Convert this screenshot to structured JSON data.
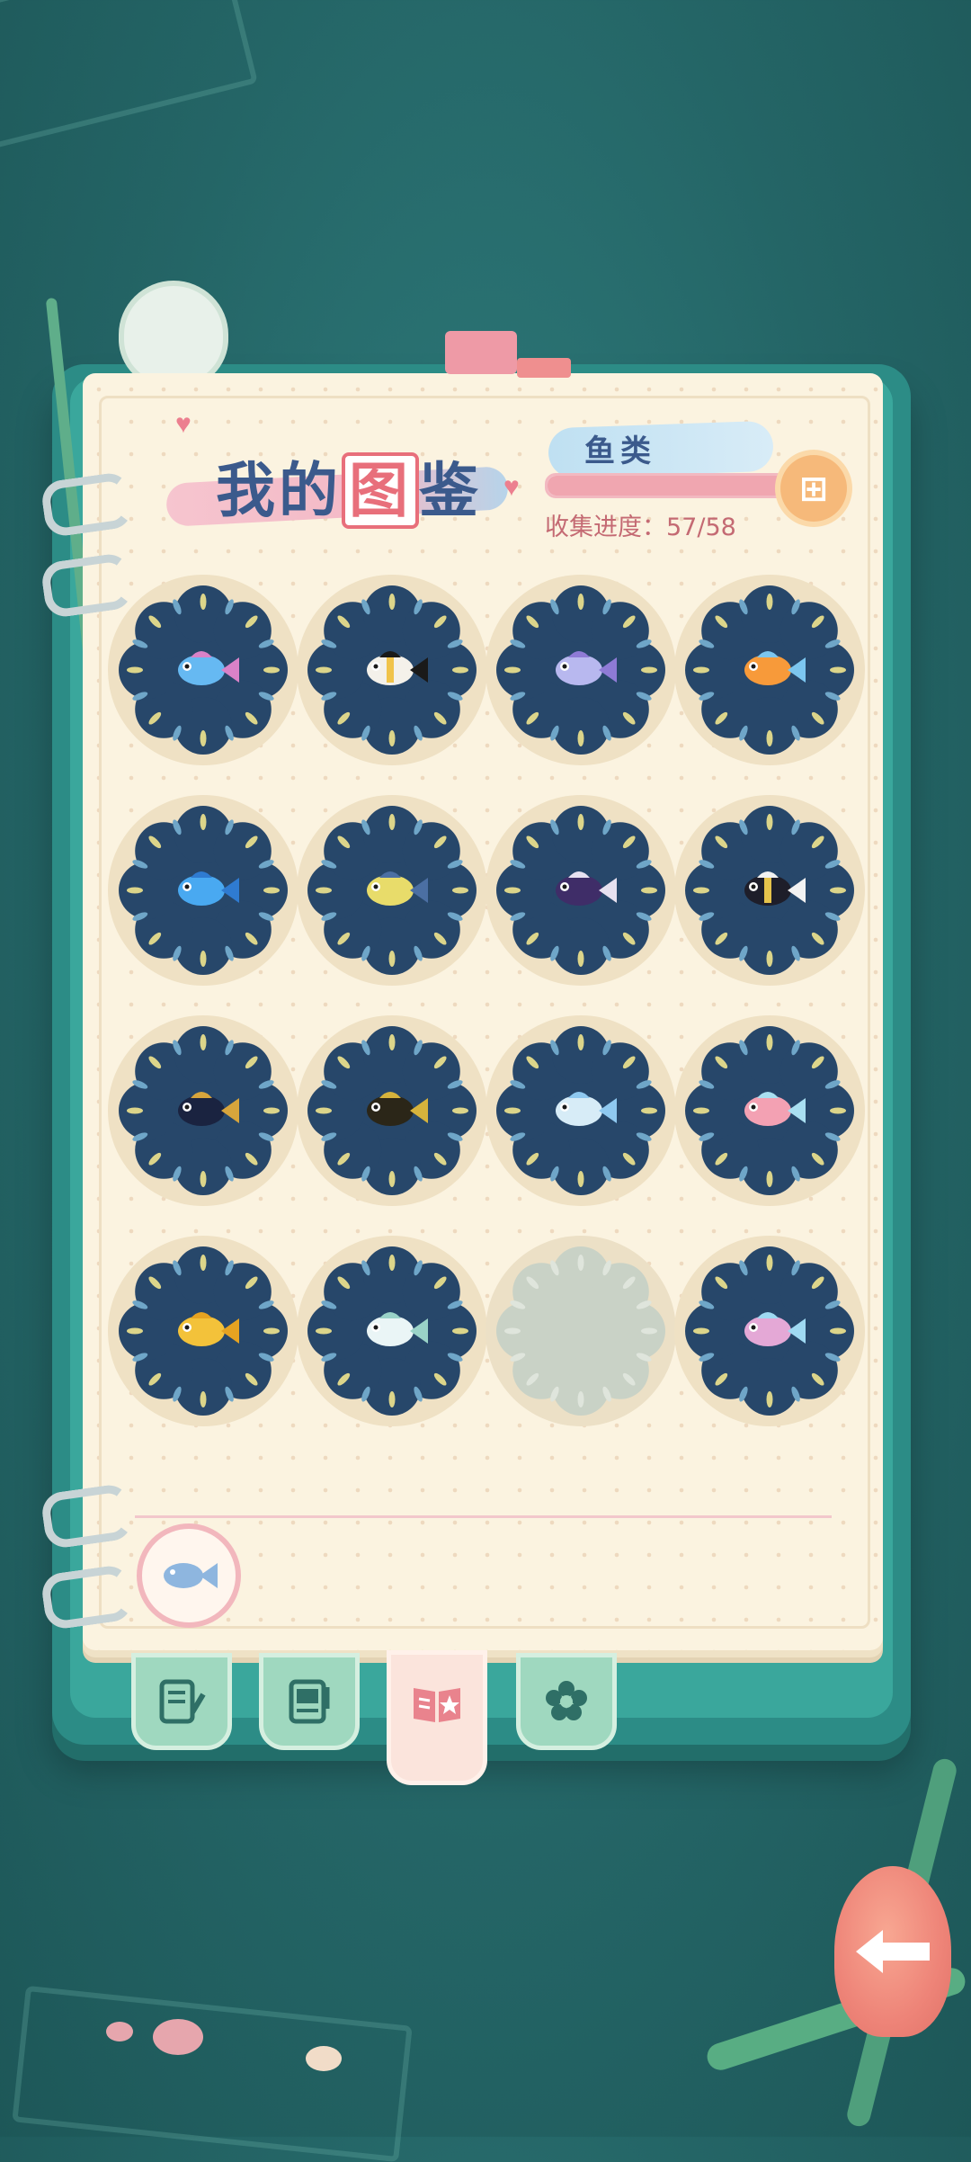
{
  "header": {
    "title_part1": "我的",
    "title_highlight": "图",
    "title_part2": "鉴",
    "category": "鱼类",
    "progress_label": "收集进度：",
    "progress_value": "57/58",
    "progress_fraction": 0.98
  },
  "colors": {
    "badge": "#27476a",
    "badge_locked": "#c9d2c6",
    "ray_yellow": "#dcd58a",
    "ray_blue": "#6fa6c8",
    "progress_fill": "#f0a6b0"
  },
  "entries": [
    {
      "name": "fish-entry-1",
      "fish": "neon-tetra",
      "colors": [
        "#66b9f2",
        "#d982c8"
      ]
    },
    {
      "name": "fish-entry-2",
      "fish": "moorish-idol",
      "colors": [
        "#f4f1ea",
        "#1a1a1a",
        "#f0c34a"
      ]
    },
    {
      "name": "fish-entry-3",
      "fish": "flying-fish",
      "colors": [
        "#b8b8ef",
        "#8f7bd6"
      ]
    },
    {
      "name": "fish-entry-4",
      "fish": "orange-tang",
      "colors": [
        "#f79a3a",
        "#7cc6ef"
      ]
    },
    {
      "name": "fish-entry-5",
      "fish": "blue-discus",
      "colors": [
        "#49a9f1",
        "#2f7bd1"
      ]
    },
    {
      "name": "fish-entry-6",
      "fish": "yellow-tang",
      "colors": [
        "#e8dc6a",
        "#4b6fa3"
      ]
    },
    {
      "name": "fish-entry-7",
      "fish": "dark-fish",
      "colors": [
        "#3f2d68",
        "#e7e1f0"
      ]
    },
    {
      "name": "fish-entry-8",
      "fish": "clown-triggerfish",
      "colors": [
        "#1e1e2a",
        "#f2f2f2",
        "#e6c34b"
      ]
    },
    {
      "name": "fish-entry-9",
      "fish": "black-angelfish",
      "colors": [
        "#1a2340",
        "#d7a53c"
      ]
    },
    {
      "name": "fish-entry-10",
      "fish": "spotted-puffer",
      "colors": [
        "#2b2618",
        "#d6b33c"
      ]
    },
    {
      "name": "fish-entry-11",
      "fish": "pale-tang",
      "colors": [
        "#d7ecf7",
        "#8fc9f0"
      ]
    },
    {
      "name": "fish-entry-12",
      "fish": "sunfish",
      "colors": [
        "#f3a1b3",
        "#a9dff1"
      ]
    },
    {
      "name": "fish-entry-13",
      "fish": "golden-koi",
      "colors": [
        "#f3c23a",
        "#e6a321"
      ]
    },
    {
      "name": "fish-entry-14",
      "fish": "flying-gurnard",
      "colors": [
        "#eaf5f6",
        "#9ad3c8"
      ]
    },
    {
      "name": "fish-entry-15",
      "fish": "locked",
      "colors": [
        "#c9d2c6"
      ]
    },
    {
      "name": "fish-entry-16",
      "fish": "stingray",
      "colors": [
        "#e4a8d6",
        "#9fd9f2"
      ]
    }
  ],
  "tabs": [
    {
      "name": "tab-notes",
      "icon": "notepad-icon"
    },
    {
      "name": "tab-album",
      "icon": "photo-note-icon"
    },
    {
      "name": "tab-collection",
      "icon": "open-book-star-icon",
      "active": true
    },
    {
      "name": "tab-flower",
      "icon": "flower-icon"
    }
  ],
  "back_button": {
    "icon": "arrow-left-icon"
  },
  "filter_button": {
    "icon": "fish-icon"
  }
}
